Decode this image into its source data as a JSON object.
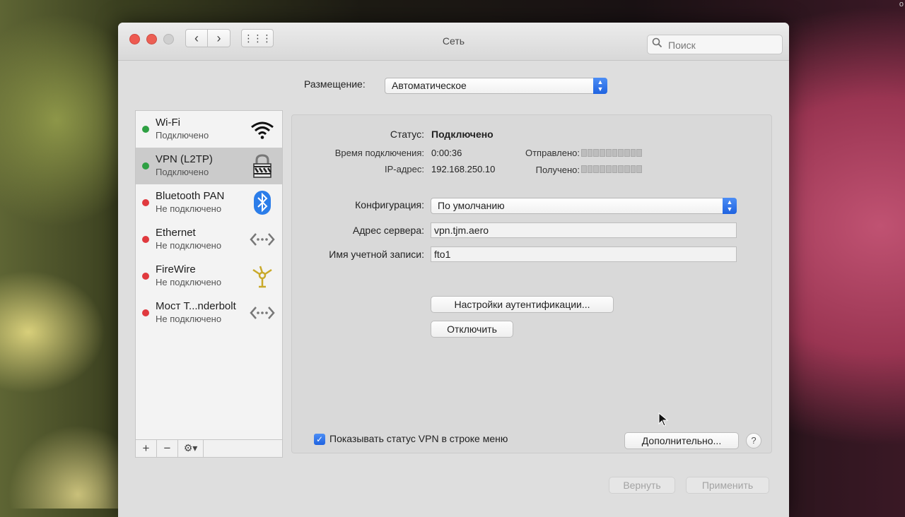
{
  "corner": {
    "text": "о"
  },
  "window": {
    "title": "Сеть",
    "nav": {
      "back": "‹",
      "forward": "›",
      "grid": "⋮⋮⋮"
    },
    "search": {
      "placeholder": "Поиск"
    }
  },
  "location": {
    "label": "Размещение:",
    "value": "Автоматическое"
  },
  "services": [
    {
      "name": "Wi-Fi",
      "status": "Подключено",
      "state": "connected",
      "icon": "wifi-icon"
    },
    {
      "name": "VPN (L2TP)",
      "status": "Подключено",
      "state": "connected",
      "icon": "vpn-lock-icon"
    },
    {
      "name": "Bluetooth PAN",
      "status": "Не подключено",
      "state": "disconnected",
      "icon": "bluetooth-icon"
    },
    {
      "name": "Ethernet",
      "status": "Не подключено",
      "state": "disconnected",
      "icon": "ethernet-arrows-icon"
    },
    {
      "name": "FireWire",
      "status": "Не подключено",
      "state": "disconnected",
      "icon": "firewire-icon"
    },
    {
      "name": "Мост T...nderbolt",
      "status": "Не подключено",
      "state": "disconnected",
      "icon": "thunderbolt-bridge-arrows-icon"
    }
  ],
  "sidebar_controls": {
    "add": "+",
    "remove": "−",
    "gear": "⚙▾"
  },
  "details": {
    "status_label": "Статус:",
    "status_value": "Подключено",
    "connect_time_label": "Время подключения:",
    "connect_time_value": "0:00:36",
    "ip_label": "IP-адрес:",
    "ip_value": "192.168.250.10",
    "sent_label": "Отправлено:",
    "received_label": "Получено:",
    "config_label": "Конфигурация:",
    "config_value": "По умолчанию",
    "server_label": "Адрес сервера:",
    "server_value": "vpn.tjm.aero",
    "account_label": "Имя учетной записи:",
    "account_value": "fto1",
    "auth_button": "Настройки аутентификации...",
    "disconnect_button": "Отключить"
  },
  "footer": {
    "show_vpn_status_label": "Показывать статус VPN в строке меню",
    "show_vpn_status_checked": true,
    "advanced_button": "Дополнительно...",
    "help_button": "?",
    "revert_button": "Вернуть",
    "apply_button": "Применить"
  },
  "colors": {
    "accent": "#2a6ee6",
    "connected": "#2ea043",
    "disconnected": "#e0393e"
  }
}
